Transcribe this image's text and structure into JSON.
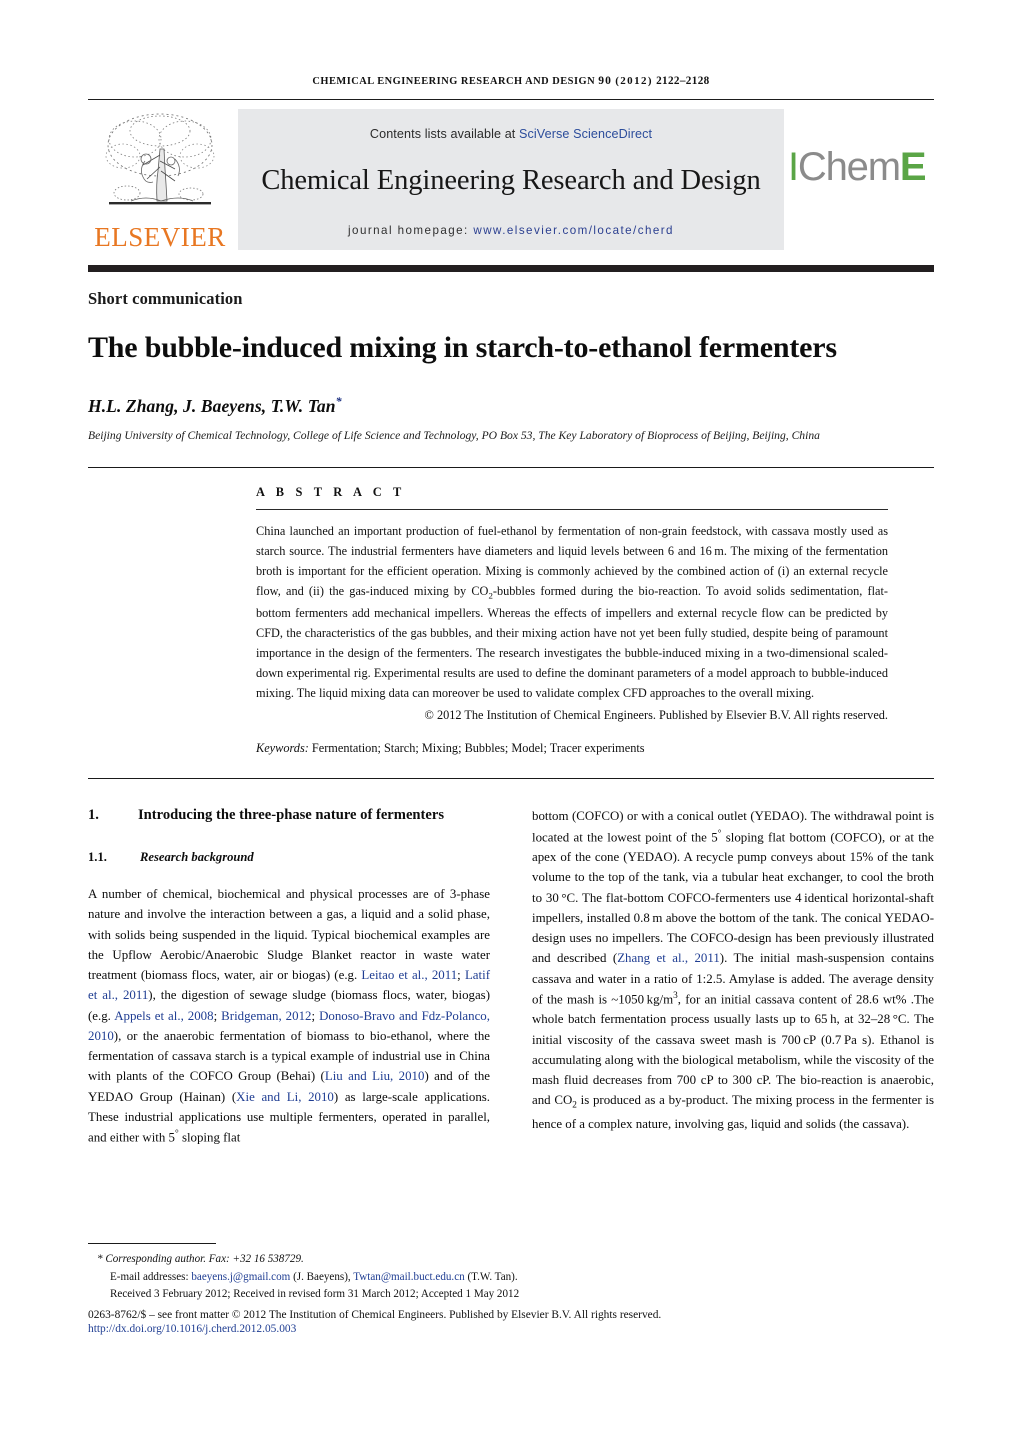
{
  "running_head": {
    "journal": "CHEMICAL ENGINEERING RESEARCH AND DESIGN",
    "volume": "90",
    "year": "(2012)",
    "pages": "2122–2128"
  },
  "masthead": {
    "contents_prefix": "Contents lists available at ",
    "contents_link": "SciVerse ScienceDirect",
    "journal_title": "Chemical Engineering Research and Design",
    "homepage_label": "journal homepage:",
    "homepage_url": "www.elsevier.com/locate/cherd",
    "elsevier_wordmark": "ELSEVIER",
    "icheme_part1": "I",
    "icheme_part2": "Chem",
    "icheme_part3": "E",
    "elsevier_orange": "#E87722",
    "icheme_green": "#5aa546",
    "link_blue": "#2b4c9b",
    "masthead_bg": "#e7e8ea"
  },
  "article": {
    "type_label": "Short communication",
    "title": "The bubble-induced mixing in starch-to-ethanol fermenters",
    "authors": "H.L. Zhang, J. Baeyens, T.W. Tan",
    "corresponding_marker": "*",
    "affiliation": "Beijing University of Chemical Technology, College of Life Science and Technology, PO Box 53, The Key Laboratory of Bioprocess of Beijing, Beijing, China"
  },
  "abstract": {
    "label": "A B S T R A C T",
    "body": "China launched an important production of fuel-ethanol by fermentation of non-grain feedstock, with cassava mostly used as starch source. The industrial fermenters have diameters and liquid levels between 6 and 16 m. The mixing of the fermentation broth is important for the efficient operation. Mixing is commonly achieved by the combined action of (i) an external recycle flow, and (ii) the gas-induced mixing by CO2-bubbles formed during the bio-reaction. To avoid solids sedimentation, flat-bottom fermenters add mechanical impellers. Whereas the effects of impellers and external recycle flow can be predicted by CFD, the characteristics of the gas bubbles, and their mixing action have not yet been fully studied, despite being of paramount importance in the design of the fermenters. The research investigates the bubble-induced mixing in a two-dimensional scaled-down experimental rig. Experimental results are used to define the dominant parameters of a model approach to bubble-induced mixing. The liquid mixing data can moreover be used to validate complex CFD approaches to the overall mixing.",
    "copyright": "© 2012 The Institution of Chemical Engineers. Published by Elsevier B.V. All rights reserved.",
    "keywords_label": "Keywords:",
    "keywords": "Fermentation; Starch; Mixing; Bubbles; Model; Tracer experiments"
  },
  "body": {
    "section_number": "1.",
    "section_title": "Introducing the three-phase nature of fermenters",
    "subsection_number": "1.1.",
    "subsection_title": "Research background",
    "left_paragraph_1": "A number of chemical, biochemical and physical processes are of 3-phase nature and involve the interaction between a gas, a liquid and a solid phase, with solids being suspended in the liquid. Typical biochemical examples are the Upflow Aerobic/Anaerobic Sludge Blanket reactor in waste water treatment (biomass flocs, water, air or biogas) (e.g. Leitao et al., 2011; Latif et al., 2011), the digestion of sewage sludge (biomass flocs, water, biogas) (e.g. Appels et al., 2008; Bridgeman, 2012; Donoso-Bravo and Fdz-Polanco, 2010), or the anaerobic fermentation of biomass to bio-ethanol, where the fermentation of cassava starch is a typical example of industrial use in China with plants of the COFCO Group (Behai) (Liu and Liu, 2010) and of the YEDAO Group (Hainan) (Xie and Li, 2010) as large-scale applications. These industrial applications use multiple fermenters, operated in parallel, and either with 5° sloping flat",
    "right_paragraph_1": "bottom (COFCO) or with a conical outlet (YEDAO). The withdrawal point is located at the lowest point of the 5° sloping flat bottom (COFCO), or at the apex of the cone (YEDAO). A recycle pump conveys about 15% of the tank volume to the top of the tank, via a tubular heat exchanger, to cool the broth to 30 °C. The flat-bottom COFCO-fermenters use 4 identical horizontal-shaft impellers, installed 0.8 m above the bottom of the tank. The conical YEDAO-design uses no impellers. The COFCO-design has been previously illustrated and described (Zhang et al., 2011). The initial mash-suspension contains cassava and water in a ratio of 1:2.5. Amylase is added. The average density of the mash is ~1050 kg/m3, for an initial cassava content of 28.6 wt% .The whole batch fermentation process usually lasts up to 65 h, at 32–28 °C. The initial viscosity of the cassava sweet mash is 700 cP (0.7 Pa s). Ethanol is accumulating along with the biological metabolism, while the viscosity of the mash fluid decreases from 700 cP to 300 cP. The bio-reaction is anaerobic, and CO2 is produced as a by-product. The mixing process in the fermenter is hence of a complex nature, involving gas, liquid and solids (the cassava)."
  },
  "footer": {
    "corresponding_marker": "*",
    "corresponding_text": "Corresponding author. Fax: +32 16 538729.",
    "email_label": "E-mail addresses:",
    "email_1": "baeyens.j@gmail.com",
    "email_1_owner": "(J. Baeyens),",
    "email_2": "Twtan@mail.buct.edu.cn",
    "email_2_owner": "(T.W. Tan).",
    "received": "Received 3 February 2012; Received in revised form 31 March 2012; Accepted 1 May 2012",
    "issn_line": "0263-8762/$ – see front matter © 2012 The Institution of Chemical Engineers. Published by Elsevier B.V. All rights reserved.",
    "doi": "http://dx.doi.org/10.1016/j.cherd.2012.05.003"
  }
}
